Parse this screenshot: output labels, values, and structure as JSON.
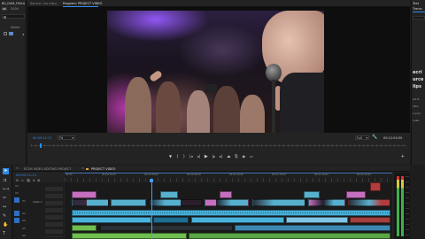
{
  "app": {
    "title": "Adobe Premiere Pro"
  },
  "left_panel": {
    "tab": "BS_DAM_FINLA",
    "project_button": "Ok",
    "project_name": "2004",
    "bin_label": "Name"
  },
  "source_panel": {
    "tab": "Source: (no clips)"
  },
  "program_monitor": {
    "tab": "Program: PROJECT VIDEO",
    "current_time": "00:00:11:11",
    "fit": "Fit",
    "quality": "Full",
    "duration": "00:12:04:00"
  },
  "right_panel": {
    "tab1": "Text",
    "tab2": "Transc",
    "lines": [
      "ecri",
      "urce",
      "lips",
      "ed to",
      "otos",
      "s your",
      "ouse."
    ]
  },
  "timeline": {
    "tabs": [
      "ECSH VIDEO EDITING PROJECT",
      "PROJECT VIDEO"
    ],
    "active_tab": 1,
    "timecode": "00:00:11:11",
    "ruler_labels": [
      "00:00",
      "00:00:15:00",
      "00:00:30:00",
      "00:00:45:00",
      "00:01:00:00",
      "00:01:15:00",
      "00:01:30:00",
      "00:01:45:00"
    ],
    "track_labels": [
      "V3",
      "V2",
      "V1",
      "A1",
      "A2",
      "A3",
      "A4"
    ],
    "video_track_name": "Video 1"
  },
  "colors": {
    "accent": "#2d8ceb",
    "video_clip": "#58b0cf",
    "video_clip_pink": "#c66fbf",
    "audio_clip": "#49b3dd",
    "audio_green": "#6fbf50",
    "playhead": "#4a9cf0",
    "record": "#e03030"
  }
}
